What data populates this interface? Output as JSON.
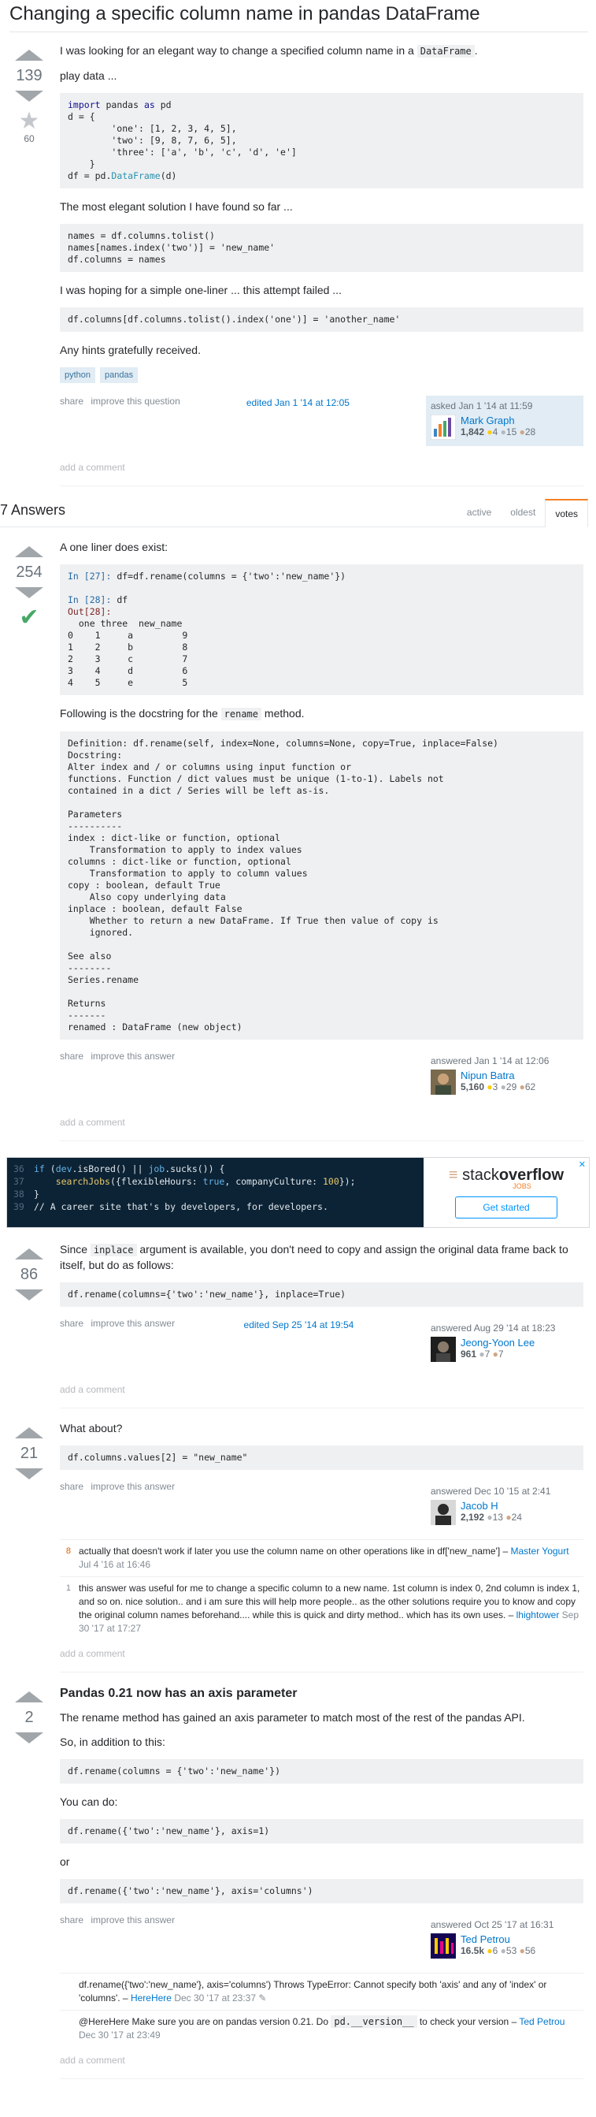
{
  "question": {
    "title": "Changing a specific column name in pandas DataFrame",
    "votes": "139",
    "favorites": "60",
    "p1_pre": "I was looking for an elegant way to change a specified column name in a ",
    "p1_code": "DataFrame",
    "p1_post": ".",
    "p2": "play data ...",
    "code1": {
      "import": "import",
      "pandas": " pandas ",
      "as": "as",
      "pd": " pd",
      "d_line": "d = {",
      "one": "        'one': [1, 2, 3, 4, 5],",
      "two": "        'two': [9, 8, 7, 6, 5],",
      "three": "        'three': ['a', 'b', 'c', 'd', 'e']",
      "close": "    }",
      "df_pre": "df = pd.",
      "df_fn": "DataFrame",
      "df_post": "(d)"
    },
    "p3": "The most elegant solution I have found so far ...",
    "code2": "names = df.columns.tolist()\nnames[names.index('two')] = 'new_name'\ndf.columns = names",
    "p4": "I was hoping for a simple one-liner ... this attempt failed ...",
    "code3": "df.columns[df.columns.tolist().index('one')] = 'another_name'",
    "p5": "Any hints gratefully received.",
    "tags": [
      "python",
      "pandas"
    ],
    "share": "share",
    "improve": "improve this question",
    "edited": "edited Jan 1 '14 at 12:05",
    "asked": "asked Jan 1 '14 at 11:59",
    "user": "Mark Graph",
    "rep": "1,842",
    "gold": "4",
    "silver": "15",
    "bronze": "28",
    "add_comment": "add a comment"
  },
  "answers_header": {
    "count": "7 Answers",
    "tabs": [
      "active",
      "oldest",
      "votes"
    ]
  },
  "answer1": {
    "votes": "254",
    "p1": "A one liner does exist:",
    "code_in27": "In [27]:",
    "code_in27_rest": " df=df.rename(columns = {'two':'new_name'})",
    "code_in28": "In [28]:",
    "code_in28_rest": " df",
    "code_out28": "Out[28]:",
    "code_table": "  one three  new_name\n0    1     a         9\n1    2     b         8\n2    3     c         7\n3    4     d         6\n4    5     e         5",
    "p2_pre": "Following is the docstring for the ",
    "p2_code": "rename",
    "p2_post": " method.",
    "docstring": "Definition: df.rename(self, index=None, columns=None, copy=True, inplace=False)\nDocstring:\nAlter index and / or columns using input function or\nfunctions. Function / dict values must be unique (1-to-1). Labels not\ncontained in a dict / Series will be left as-is.\n\nParameters\n----------\nindex : dict-like or function, optional\n    Transformation to apply to index values\ncolumns : dict-like or function, optional\n    Transformation to apply to column values\ncopy : boolean, default True\n    Also copy underlying data\ninplace : boolean, default False\n    Whether to return a new DataFrame. If True then value of copy is\n    ignored.\n\nSee also\n--------\nSeries.rename\n\nReturns\n-------\nrenamed : DataFrame (new object)",
    "share": "share",
    "improve": "improve this answer",
    "answered": "answered Jan 1 '14 at 12:06",
    "user": "Nipun Batra",
    "rep": "5,160",
    "gold": "3",
    "silver": "29",
    "bronze": "62",
    "add_comment": "add a comment"
  },
  "ad": {
    "line_nums": [
      "36",
      "37",
      "38",
      "39"
    ],
    "l1_if": "if",
    "l1_a": " (",
    "l1_dev": "dev",
    "l1_b": ".isBored() || ",
    "l1_job": "job",
    "l1_c": ".sucks()) {",
    "l2_a": "    searchJobs",
    "l2_b": "({flexibleHours: ",
    "l2_true": "true",
    "l2_c": ", companyCulture: ",
    "l2_100": "100",
    "l2_d": "});",
    "l3": "}",
    "l4": "// A career site that's by developers, for developers.",
    "logo_a": "stack",
    "logo_b": "overflow",
    "jobs": "JOBS",
    "button": "Get started",
    "close": "✕"
  },
  "answer2": {
    "votes": "86",
    "p1_pre": "Since ",
    "p1_code": "inplace",
    "p1_post": " argument is available, you don't need to copy and assign the original data frame back to itself, but do as follows:",
    "code": "df.rename(columns={'two':'new_name'}, inplace=True)",
    "share": "share",
    "improve": "improve this answer",
    "edited": "edited Sep 25 '14 at 19:54",
    "answered": "answered Aug 29 '14 at 18:23",
    "user": "Jeong-Yoon Lee",
    "rep": "961",
    "gold": "",
    "silver": "7",
    "bronze": "7",
    "add_comment": "add a comment"
  },
  "answer3": {
    "votes": "21",
    "p1": "What about?",
    "code": "df.columns.values[2] = \"new_name\"",
    "share": "share",
    "improve": "improve this answer",
    "answered": "answered Dec 10 '15 at 2:41",
    "user": "Jacob H",
    "rep": "2,192",
    "silver": "13",
    "bronze": "24",
    "comments": [
      {
        "score": "8",
        "text": "actually that doesn't work if later you use the column name on other operations like in df['new_name'] – ",
        "user": "Master Yogurt",
        "date": " Jul 4 '16 at 16:46"
      },
      {
        "score": "1",
        "text": "this answer was useful for me to change a specific column to a new name. 1st column is index 0, 2nd column is index 1, and so on. nice solution.. and i am sure this will help more people.. as the other solutions require you to know and copy the original column names beforehand.... while this is quick and dirty method.. which has its own uses. – ",
        "user": "lhightower",
        "date": " Sep 30 '17 at 17:27"
      }
    ],
    "add_comment": "add a comment"
  },
  "answer4": {
    "votes": "2",
    "heading": "Pandas 0.21 now has an axis parameter",
    "p1": "The rename method has gained an axis parameter to match most of the rest of the pandas API.",
    "p2": "So, in addition to this:",
    "code1": "df.rename(columns = {'two':'new_name'})",
    "p3": "You can do:",
    "code2": "df.rename({'two':'new_name'}, axis=1)",
    "p4": "or",
    "code3": "df.rename({'two':'new_name'}, axis='columns')",
    "share": "share",
    "improve": "improve this answer",
    "answered": "answered Oct 25 '17 at 16:31",
    "user": "Ted Petrou",
    "rep": "16.5k",
    "gold": "6",
    "silver": "53",
    "bronze": "56",
    "comments": [
      {
        "score": "",
        "text": "df.rename({'two':'new_name'}, axis='columns') Throws TypeError: Cannot specify both 'axis' and any of 'index' or 'columns'. – ",
        "user": "HereHere",
        "date": " Dec 30 '17 at 23:37"
      },
      {
        "score": "",
        "text_pre": "@HereHere Make sure you are on pandas version 0.21. Do ",
        "code": "pd.__version__",
        "text_post": " to check your version – ",
        "user": "Ted Petrou",
        "date": " Dec 30 '17 at 23:49"
      }
    ],
    "add_comment": "add a comment"
  }
}
